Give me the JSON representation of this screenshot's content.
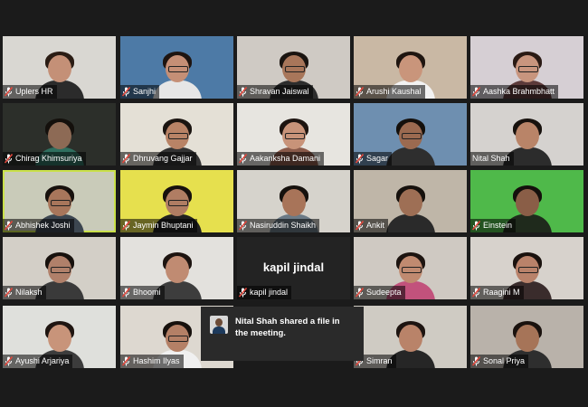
{
  "participants": [
    {
      "name": "Uplers HR",
      "muted": true,
      "bg": "#d9d7d2",
      "skin": "#c49077",
      "hair": "#2a1c14",
      "shirt": "#2b2b2b",
      "glasses": false
    },
    {
      "name": "Sanjhi",
      "muted": true,
      "bg": "#4d7aa6",
      "skin": "#c58f76",
      "hair": "#1e1410",
      "shirt": "#e6e6e6",
      "glasses": true
    },
    {
      "name": "Shravan Jaiswal",
      "muted": true,
      "bg": "#cfcac4",
      "skin": "#a8765a",
      "hair": "#1a1410",
      "shirt": "#2d2d2d",
      "glasses": true
    },
    {
      "name": "Arushi Kaushal",
      "muted": true,
      "bg": "#c9b8a4",
      "skin": "#c9957b",
      "hair": "#1f1510",
      "shirt": "#f2f2f2",
      "glasses": false
    },
    {
      "name": "Aashka Brahmbhatt",
      "muted": true,
      "bg": "#d6cfd4",
      "skin": "#c8957e",
      "hair": "#2a1a14",
      "shirt": "#5c3a3a",
      "glasses": true
    },
    {
      "name": "Chirag Khimsuriya",
      "muted": true,
      "bg": "#2c2f2a",
      "skin": "#8d6a55",
      "hair": "#14100c",
      "shirt": "#2f6f5f",
      "glasses": false
    },
    {
      "name": "Dhruvang Gajjar",
      "muted": true,
      "bg": "#e4e0d6",
      "skin": "#b88366",
      "hair": "#1a1410",
      "shirt": "#333333",
      "glasses": true
    },
    {
      "name": "Aakanksha Damani",
      "muted": true,
      "bg": "#e7e5e0",
      "skin": "#c89379",
      "hair": "#1d1410",
      "shirt": "#8a5a4a",
      "glasses": true
    },
    {
      "name": "Sagar",
      "muted": true,
      "bg": "#6e8fb0",
      "skin": "#9b6a50",
      "hair": "#14100c",
      "shirt": "#2e2e2e",
      "glasses": true
    },
    {
      "name": "Nital Shah",
      "muted": false,
      "bg": "#d5d2cf",
      "skin": "#b98468",
      "hair": "#17110d",
      "shirt": "#2c2c2c",
      "glasses": false
    },
    {
      "name": "Abhishek Joshi",
      "muted": true,
      "bg": "#c9cbb9",
      "skin": "#a8765b",
      "hair": "#17110d",
      "shirt": "#3c4650",
      "glasses": true
    },
    {
      "name": "Jaymin Bhuptani",
      "muted": true,
      "bg": "#e6e04e",
      "skin": "#b07d63",
      "hair": "#17110d",
      "shirt": "#202020",
      "glasses": true
    },
    {
      "name": "Nasiruddin Shaikh",
      "muted": true,
      "bg": "#d6d3cc",
      "skin": "#a87459",
      "hair": "#16110d",
      "shirt": "#6b7a86",
      "glasses": false
    },
    {
      "name": "Ankit",
      "muted": true,
      "bg": "#bfb6a8",
      "skin": "#9e6f55",
      "hair": "#16110d",
      "shirt": "#2a2a2a",
      "glasses": false
    },
    {
      "name": "Einstein",
      "muted": true,
      "bg": "#4fb94a",
      "skin": "#8a5e47",
      "hair": "#14100c",
      "shirt": "#1f2a1c",
      "glasses": false
    },
    {
      "name": "Nilaksh",
      "muted": true,
      "bg": "#d3cfc7",
      "skin": "#b0806a",
      "hair": "#17110d",
      "shirt": "#3a3a3a",
      "glasses": true
    },
    {
      "name": "Bhoomi",
      "muted": true,
      "bg": "#e3e1dd",
      "skin": "#c08b72",
      "hair": "#1d1410",
      "shirt": "#3d3d3d",
      "glasses": false
    },
    {
      "name": "kapil jindal",
      "muted": true,
      "bg": "#232323",
      "big": true
    },
    {
      "name": "Sudeepta",
      "muted": true,
      "bg": "#cfc9c2",
      "skin": "#c08a70",
      "hair": "#1d1410",
      "shirt": "#c2527c",
      "glasses": true
    },
    {
      "name": "Raagini M",
      "muted": true,
      "bg": "#d7d2cc",
      "skin": "#b9826a",
      "hair": "#1a120e",
      "shirt": "#3a2c2c",
      "glasses": true
    },
    {
      "name": "Ayushi Arjariya",
      "muted": true,
      "bg": "#dfe0dc",
      "skin": "#c8947a",
      "hair": "#1f1511",
      "shirt": "#3c3c3c",
      "glasses": false
    },
    {
      "name": "Hashim Ilyas",
      "muted": true,
      "bg": "#ddd8d0",
      "skin": "#b48066",
      "hair": "#17110d",
      "shirt": "#f0f0f0",
      "glasses": true
    },
    {
      "name": "",
      "muted": false,
      "bg": "#2a2a2a",
      "hidden": true
    },
    {
      "name": "Simran",
      "muted": true,
      "bg": "#cfcbc3",
      "skin": "#b98369",
      "hair": "#1d1410",
      "shirt": "#262626",
      "glasses": false
    },
    {
      "name": "Sonal Priya",
      "muted": true,
      "bg": "#b9b2aa",
      "skin": "#a67458",
      "hair": "#1a120e",
      "shirt": "#2e2e2e",
      "glasses": false
    }
  ],
  "toast": {
    "message": "Nital Shah shared a file in the meeting."
  },
  "colors": {
    "mic_muted": "#e0473c",
    "active_speaker": "#c9e04a"
  }
}
